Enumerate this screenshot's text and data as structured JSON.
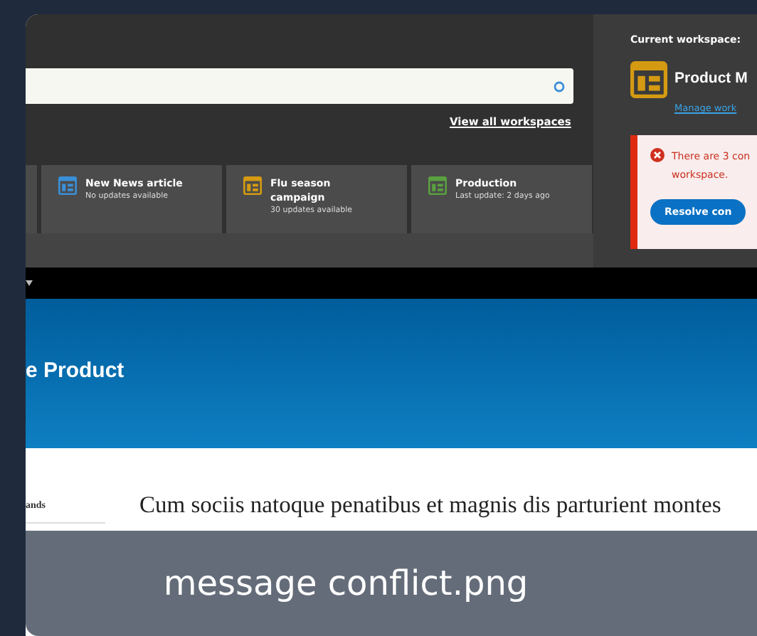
{
  "header": {
    "view_all_link": "View all workspaces",
    "workspaces": [
      {
        "color": "#4a4a4a"
      },
      {
        "title": "New News article",
        "subtitle": "No updates available",
        "color": "#3b8fd8"
      },
      {
        "title": "Flu season campaign",
        "subtitle": "30 updates available",
        "color": "#d49a12"
      },
      {
        "title": "Production",
        "subtitle": "Last update: 2 days ago",
        "color": "#5aa040"
      }
    ]
  },
  "current_workspace": {
    "label": "Current workspace:",
    "name": "Product M",
    "manage_link": "Manage work",
    "alert": {
      "message": "There are 3 con workspace.",
      "button": "Resolve con"
    }
  },
  "site": {
    "banner_title": "e Product",
    "sidebar": {
      "title": "ands"
    },
    "article": {
      "title": "Cum sociis natoque penatibus et magnis dis parturient montes"
    }
  },
  "caption": "message conflict.png"
}
